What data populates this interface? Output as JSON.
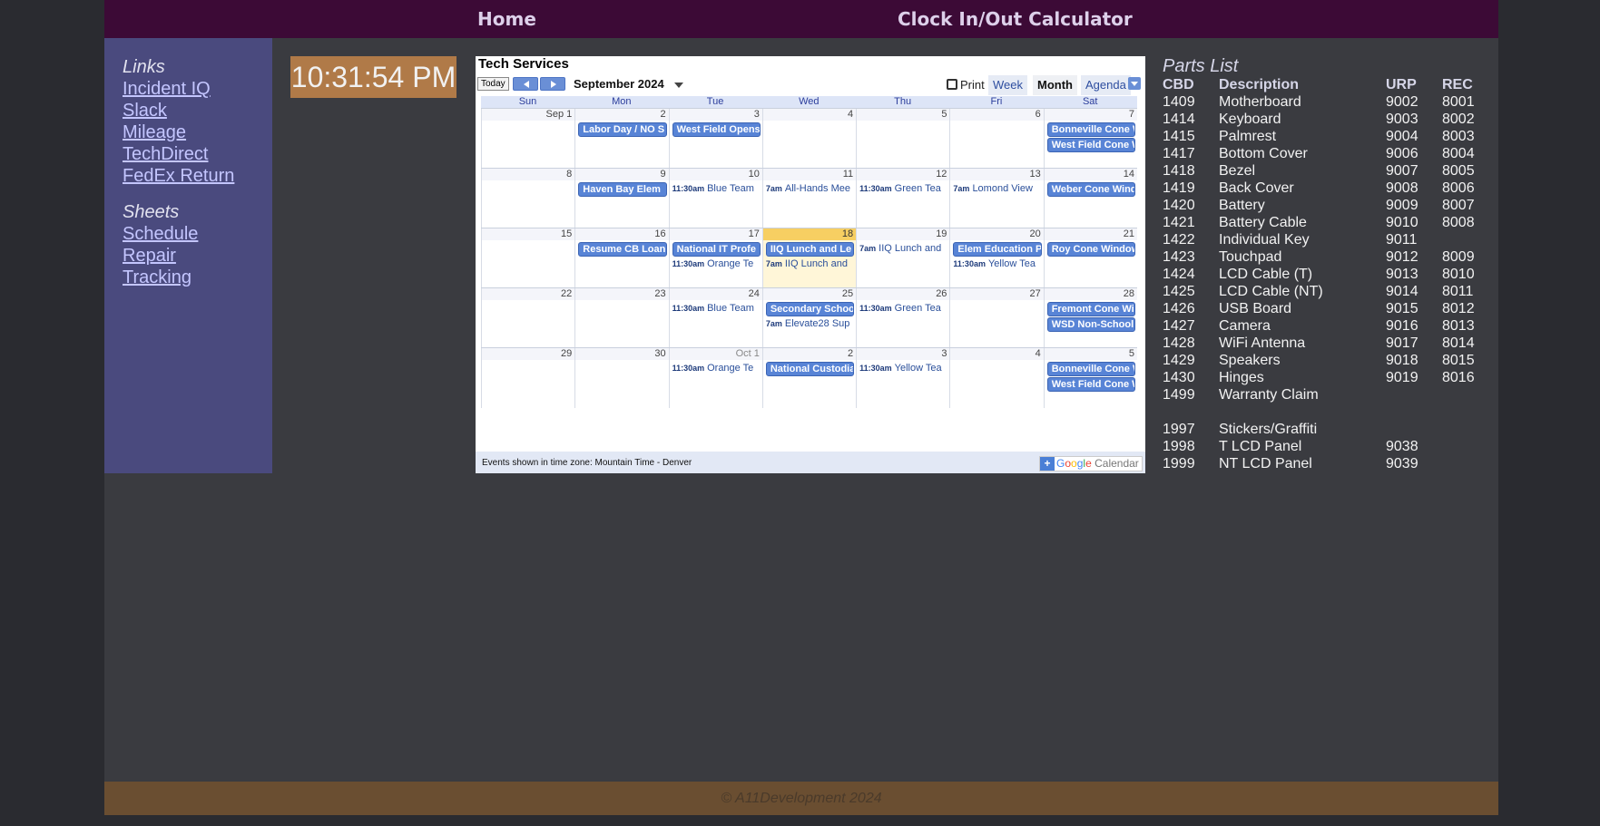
{
  "topnav": {
    "home": "Home",
    "clock_calc": "Clock In/Out Calculator"
  },
  "sidebar": {
    "links_heading": "Links",
    "links": [
      "Incident IQ",
      "Slack",
      "Mileage",
      "TechDirect",
      "FedEx Return"
    ],
    "sheets_heading": "Sheets",
    "sheets": [
      "Schedule",
      "Repair",
      "Tracking"
    ]
  },
  "clock": {
    "time": "10:31:54 PM"
  },
  "calendar": {
    "title": "Tech Services",
    "today_button": "Today",
    "month_label": "September 2024",
    "print": "Print",
    "tabs": [
      "Week",
      "Month",
      "Agenda"
    ],
    "active_tab": "Month",
    "days_of_week": [
      "Sun",
      "Mon",
      "Tue",
      "Wed",
      "Thu",
      "Fri",
      "Sat"
    ],
    "weeks": [
      {
        "days": [
          "Sep 1",
          "2",
          "3",
          "4",
          "5",
          "6",
          "7"
        ],
        "events": [
          {
            "day": 1,
            "slot": 0,
            "kind": "block",
            "text": "Labor Day / NO S"
          },
          {
            "day": 2,
            "slot": 0,
            "kind": "block",
            "text": "West Field Opens"
          },
          {
            "day": 6,
            "slot": 0,
            "kind": "block",
            "text": "Bonneville Cone W"
          },
          {
            "day": 6,
            "slot": 1,
            "kind": "block",
            "text": "West Field Cone W"
          }
        ]
      },
      {
        "days": [
          "8",
          "9",
          "10",
          "11",
          "12",
          "13",
          "14"
        ],
        "events": [
          {
            "day": 1,
            "slot": 0,
            "kind": "block",
            "text": "Haven Bay Elem"
          },
          {
            "day": 2,
            "slot": 0,
            "kind": "text",
            "time": "11:30am",
            "text": "Blue Team"
          },
          {
            "day": 3,
            "slot": 0,
            "kind": "text",
            "time": "7am",
            "text": "All-Hands Mee"
          },
          {
            "day": 4,
            "slot": 0,
            "kind": "text",
            "time": "11:30am",
            "text": "Green Tea"
          },
          {
            "day": 5,
            "slot": 0,
            "kind": "text",
            "time": "7am",
            "text": "Lomond View"
          },
          {
            "day": 6,
            "slot": 0,
            "kind": "block",
            "text": "Weber Cone Wind"
          }
        ]
      },
      {
        "days": [
          "15",
          "16",
          "17",
          "18",
          "19",
          "20",
          "21"
        ],
        "today_index": 3,
        "events": [
          {
            "day": 1,
            "slot": 0,
            "kind": "block",
            "text": "Resume CB Loan"
          },
          {
            "day": 2,
            "slot": 0,
            "kind": "block",
            "text": "National IT Profe"
          },
          {
            "day": 2,
            "slot": 1,
            "kind": "text",
            "time": "11:30am",
            "text": "Orange Te"
          },
          {
            "day": 3,
            "slot": 0,
            "kind": "block",
            "text": "IIQ Lunch and Le"
          },
          {
            "day": 3,
            "slot": 1,
            "kind": "text",
            "time": "7am",
            "text": "IIQ Lunch and"
          },
          {
            "day": 4,
            "slot": 0,
            "kind": "text",
            "time": "7am",
            "text": "IIQ Lunch and"
          },
          {
            "day": 5,
            "slot": 0,
            "kind": "block",
            "text": "Elem Education P"
          },
          {
            "day": 5,
            "slot": 1,
            "kind": "text",
            "time": "11:30am",
            "text": "Yellow Tea"
          },
          {
            "day": 6,
            "slot": 0,
            "kind": "block",
            "text": "Roy Cone Window"
          }
        ]
      },
      {
        "days": [
          "22",
          "23",
          "24",
          "25",
          "26",
          "27",
          "28"
        ],
        "events": [
          {
            "day": 2,
            "slot": 0,
            "kind": "text",
            "time": "11:30am",
            "text": "Blue Team"
          },
          {
            "day": 3,
            "slot": 0,
            "kind": "block",
            "text": "Secondary Schoo"
          },
          {
            "day": 3,
            "slot": 1,
            "kind": "text",
            "time": "7am",
            "text": "Elevate28 Sup"
          },
          {
            "day": 4,
            "slot": 0,
            "kind": "text",
            "time": "11:30am",
            "text": "Green Tea"
          },
          {
            "day": 6,
            "slot": 0,
            "kind": "block",
            "text": "Fremont Cone Wi"
          },
          {
            "day": 6,
            "slot": 1,
            "kind": "block",
            "text": "WSD Non-School"
          }
        ]
      },
      {
        "days": [
          "29",
          "30",
          "Oct 1",
          "2",
          "3",
          "4",
          "5"
        ],
        "other_from": 2,
        "events": [
          {
            "day": 2,
            "slot": 0,
            "kind": "text",
            "time": "11:30am",
            "text": "Orange Te"
          },
          {
            "day": 3,
            "slot": 0,
            "kind": "block",
            "text": "National Custodia"
          },
          {
            "day": 4,
            "slot": 0,
            "kind": "text",
            "time": "11:30am",
            "text": "Yellow Tea"
          },
          {
            "day": 6,
            "slot": 0,
            "kind": "block",
            "text": "Bonneville Cone W"
          },
          {
            "day": 6,
            "slot": 1,
            "kind": "block",
            "text": "West Field Cone W"
          }
        ]
      }
    ],
    "timezone_note": "Events shown in time zone: Mountain Time - Denver",
    "badge": {
      "plus": "+",
      "g": "G",
      "o1": "o",
      "o2": "o",
      "g2": "g",
      "l": "l",
      "e": "e",
      "cal": "Calendar"
    }
  },
  "parts": {
    "title": "Parts List",
    "headers": [
      "CBD",
      "Description",
      "URP",
      "REC"
    ],
    "rows": [
      [
        "1409",
        "Motherboard",
        "9002",
        "8001"
      ],
      [
        "1414",
        "Keyboard",
        "9003",
        "8002"
      ],
      [
        "1415",
        "Palmrest",
        "9004",
        "8003"
      ],
      [
        "1417",
        "Bottom Cover",
        "9006",
        "8004"
      ],
      [
        "1418",
        "Bezel",
        "9007",
        "8005"
      ],
      [
        "1419",
        "Back Cover",
        "9008",
        "8006"
      ],
      [
        "1420",
        "Battery",
        "9009",
        "8007"
      ],
      [
        "1421",
        "Battery Cable",
        "9010",
        "8008"
      ],
      [
        "1422",
        "Individual Key",
        "9011",
        ""
      ],
      [
        "1423",
        "Touchpad",
        "9012",
        "8009"
      ],
      [
        "1424",
        "LCD Cable (T)",
        "9013",
        "8010"
      ],
      [
        "1425",
        "LCD Cable (NT)",
        "9014",
        "8011"
      ],
      [
        "1426",
        "USB Board",
        "9015",
        "8012"
      ],
      [
        "1427",
        "Camera",
        "9016",
        "8013"
      ],
      [
        "1428",
        "WiFi Antenna",
        "9017",
        "8014"
      ],
      [
        "1429",
        "Speakers",
        "9018",
        "8015"
      ],
      [
        "1430",
        "Hinges",
        "9019",
        "8016"
      ],
      [
        "1499",
        "Warranty Claim",
        "",
        ""
      ],
      [
        "",
        "",
        "",
        ""
      ],
      [
        "1997",
        "Stickers/Graffiti",
        "",
        ""
      ],
      [
        "1998",
        "T LCD Panel",
        "9038",
        ""
      ],
      [
        "1999",
        "NT LCD Panel",
        "9039",
        ""
      ]
    ]
  },
  "footer": {
    "text": "© A11Development 2024"
  }
}
